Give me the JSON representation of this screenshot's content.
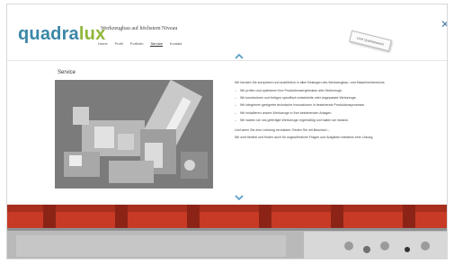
{
  "header": {
    "logo_part1": "quadra",
    "logo_part2": "lux",
    "tagline": "Werkzeugbau auf höchstem Niveau",
    "nav": [
      "Home",
      "Profil",
      "Portfolio",
      "Service",
      "Kontakt"
    ],
    "nav_active": "Service",
    "stamp_text": "Linie Qualitätsarbeit"
  },
  "main": {
    "section_title": "Service",
    "intro": "Wir beraten Sie kompetent und ausführlich in allen Belangen des Werkzeugbau- und Maschinenbereichs.",
    "bullets": [
      "Wir prüfen und optimieren Ihre Produktionsergebnisse aller Werkzeuge.",
      "Wir konstruieren und fertigen spezifisch entwickelte oder angepasste Werkzeuge.",
      "Wir integrieren geeignete technische Innovationen in bestehende Produktionsprozesse.",
      "Wir installieren unsere Werkzeuge in Ihre bestehenden Anlagen.",
      "Wir warten sie uns gefertigte Werkzeuge regelmäßig und halten sie instand."
    ],
    "outro1": "Und wenn Sie eine Leistung vermissen: Reden Sie mit Beschied –",
    "outro2": "Wir sind flexibel und finden auch für ungewöhnliche Fragen und Aufgaben meistens eine Lösung."
  },
  "icons": {
    "close": "close-icon",
    "up": "chevron-up-icon",
    "down": "chevron-down-icon"
  },
  "colors": {
    "logo_blue": "#3a87a8",
    "logo_green": "#8fb63a",
    "chevron": "#5b9fc9",
    "strip_red": "#c83a26"
  }
}
